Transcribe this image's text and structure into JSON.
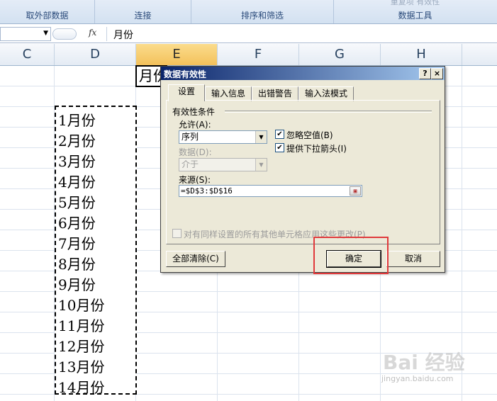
{
  "ribbon": {
    "groups": [
      {
        "label": "取外部数据"
      },
      {
        "label": "连接"
      },
      {
        "label": "排序和筛选"
      },
      {
        "label": "数据工具"
      }
    ],
    "faded_top": "重复项 有效性"
  },
  "formula_bar": {
    "fx_label": "fx",
    "value": "月份"
  },
  "columns": [
    {
      "label": "C"
    },
    {
      "label": "D"
    },
    {
      "label": "E",
      "selected": true
    },
    {
      "label": "F"
    },
    {
      "label": "G"
    },
    {
      "label": "H"
    }
  ],
  "active_cell_text": "月份",
  "months": [
    "1月份",
    "2月份",
    "3月份",
    "4月份",
    "5月份",
    "6月份",
    "7月份",
    "8月份",
    "9月份",
    "10月份",
    "11月份",
    "12月份",
    "13月份",
    "14月份"
  ],
  "dialog": {
    "title": "数据有效性",
    "help_label": "?",
    "close_label": "×",
    "tabs": [
      "设置",
      "输入信息",
      "出错警告",
      "输入法模式"
    ],
    "section_title": "有效性条件",
    "allow_label": "允许(A):",
    "allow_value": "序列",
    "data_label": "数据(D):",
    "data_value": "介于",
    "ignore_blank_label": "忽略空值(B)",
    "ignore_blank_checked": true,
    "dropdown_label": "提供下拉箭头(I)",
    "dropdown_checked": true,
    "source_label": "来源(S):",
    "source_value": "=$D$3:$D$16",
    "apply_all_label": "对有同样设置的所有其他单元格应用这些更改(P)",
    "apply_all_checked": false,
    "clear_all_label": "全部清除(C)",
    "ok_label": "确定",
    "cancel_label": "取消"
  },
  "colors": {
    "highlight_box": "#e0393b",
    "title_bar": "#0a246a",
    "selected_column": "#f3c15b"
  },
  "watermark": {
    "brand": "Bai 经验",
    "url": "jingyan.baidu.com"
  }
}
